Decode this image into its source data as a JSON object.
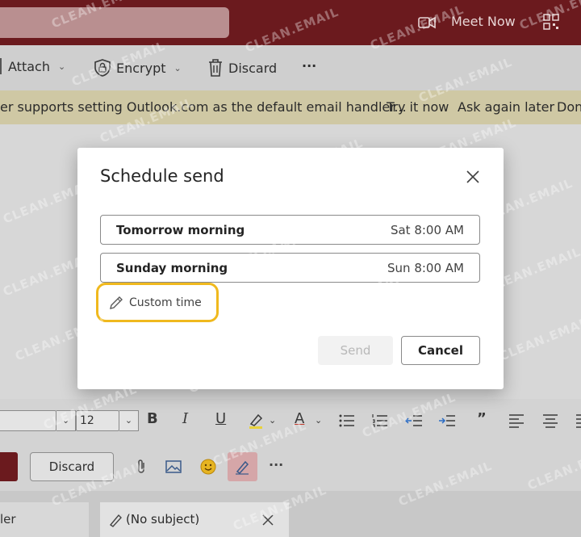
{
  "topbar": {
    "meet_now_label": "Meet Now"
  },
  "toolbar": {
    "attach_label": "Attach",
    "encrypt_label": "Encrypt",
    "discard_label": "Discard",
    "more_label": "···"
  },
  "infobar": {
    "message": "er supports setting Outlook.com as the default email handler...",
    "try_label": "Try it now",
    "ask_label": "Ask again later",
    "dont_label": "Don"
  },
  "formatbar": {
    "font_size": "12",
    "bold": "B",
    "italic": "I",
    "underline": "U",
    "font_color": "A",
    "quote": "”"
  },
  "sendrow": {
    "discard_label": "Discard",
    "more_label": "···"
  },
  "tabs": {
    "left_label": "ler",
    "subject_label": "(No subject)"
  },
  "dialog": {
    "title": "Schedule send",
    "options": [
      {
        "label": "Tomorrow morning",
        "time": "Sat 8:00 AM"
      },
      {
        "label": "Sunday morning",
        "time": "Sun 8:00 AM"
      }
    ],
    "custom_time_label": "Custom time",
    "send_label": "Send",
    "cancel_label": "Cancel"
  },
  "watermark": "CLEAN.EMAIL",
  "colors": {
    "brand_bar": "#6b1a1e",
    "highlight": "#f0b91e",
    "infobar": "#cfc8a4"
  }
}
